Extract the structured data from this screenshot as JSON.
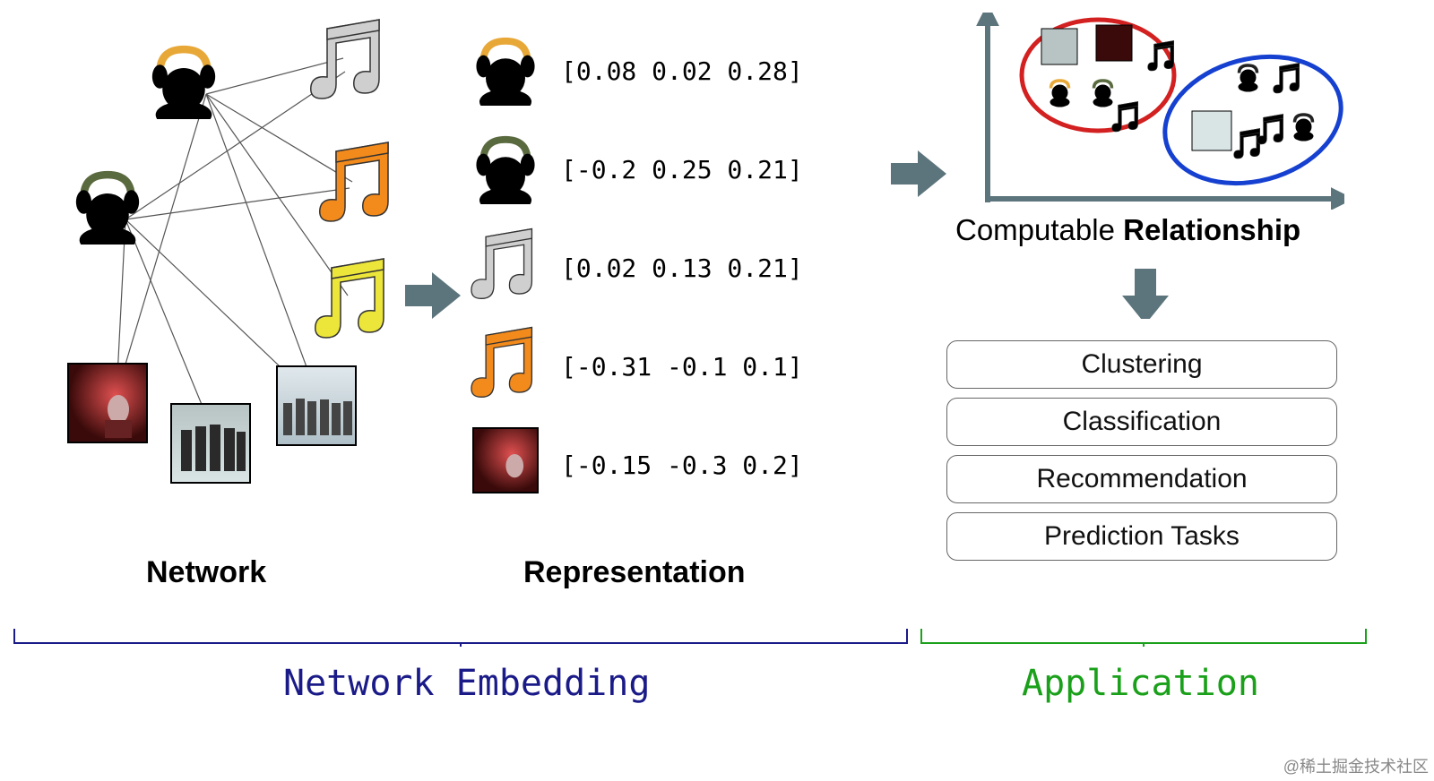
{
  "labels": {
    "network": "Network",
    "representation": "Representation",
    "computable": "Computable",
    "relationship": "Relationship",
    "netemb": "Network Embedding",
    "application": "Application"
  },
  "vectors": [
    "[0.08 0.02 0.28]",
    "[-0.2 0.25 0.21]",
    "[0.02 0.13 0.21]",
    "[-0.31 -0.1 0.1]",
    "[-0.15 -0.3 0.2]"
  ],
  "apps": [
    "Clustering",
    "Classification",
    "Recommendation",
    "Prediction Tasks"
  ],
  "watermark": "@稀土掘金技术社区"
}
